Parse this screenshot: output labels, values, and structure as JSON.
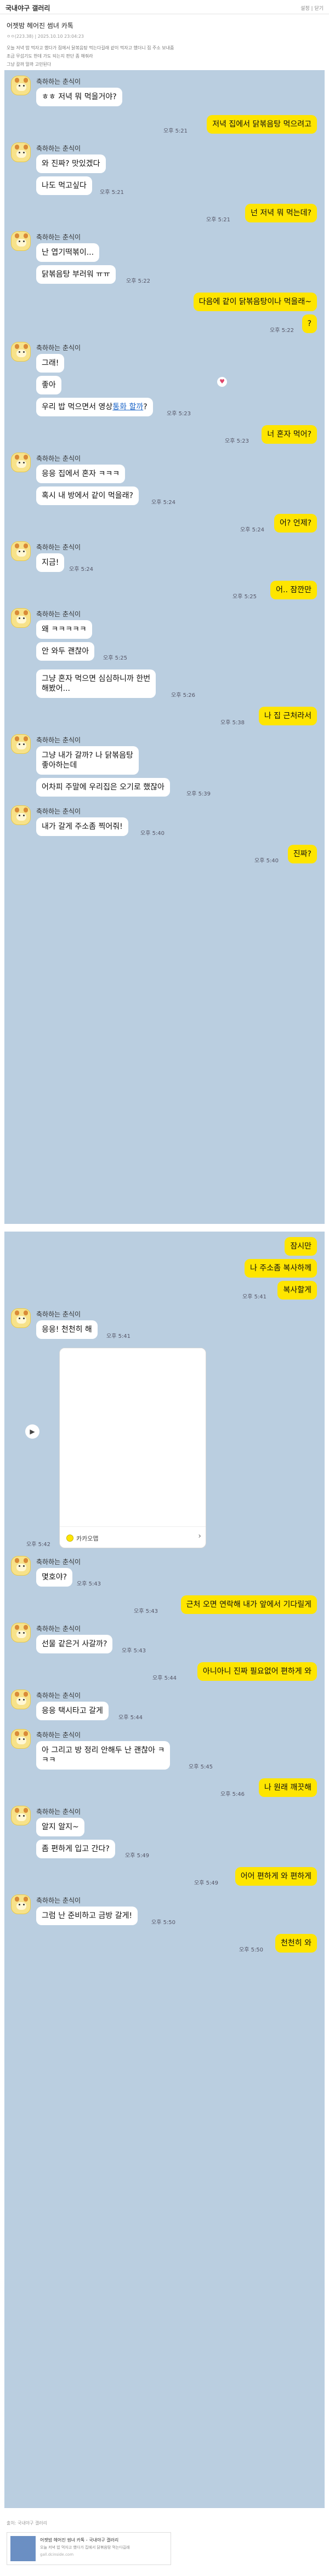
{
  "site": {
    "gallery": "국내야구 갤러리",
    "top_right": "설정 | 닫기"
  },
  "article": {
    "title": "어젯밤 헤어진 썸녀 카톡",
    "meta": "ㅇㅇ(223.38) | 2025.10.10 23:04:23",
    "body": [
      "오늘 저녁 밥 먹자고 했다가 집에서 닭볶음탕 먹는다길래 같이 먹자고 했더니 집 주소 보내줌",
      "조금 무섭기도 한데 가도 되는지 판단 좀 해줘라",
      "그냥 갈까 말까 고민된다"
    ]
  },
  "sender": "축하하는 춘식이",
  "chat": [
    {
      "s": "l",
      "name": true,
      "bubbles": [
        "ㅎㅎ 저녁 뭐 먹을거야?"
      ]
    },
    {
      "s": "r",
      "bubbles": [
        "저녁 집에서 닭볶음탕 먹으려고"
      ],
      "time": "오후 5:21"
    },
    {
      "s": "l",
      "name": true,
      "bubbles": [
        "와 진짜? 맛있겠다",
        "나도 먹고싶다"
      ],
      "time": "오후 5:21"
    },
    {
      "s": "r",
      "bubbles": [
        "넌 저녁 뭐 먹는데?"
      ],
      "time": "오후 5:21"
    },
    {
      "s": "l",
      "name": true,
      "bubbles": [
        "난 엽기떡볶이...",
        "닭볶음탕 부러워 ㅠㅠ"
      ],
      "time": "오후 5:22"
    },
    {
      "s": "r",
      "bubbles": [
        "다음에 같이 닭볶음탕이나 먹을래~",
        "?"
      ],
      "time": "오후 5:22"
    },
    {
      "s": "l",
      "name": true,
      "bubbles": [
        "그래!",
        "좋아",
        "우리 밥 먹으면서 영상통화 할까?"
      ],
      "time": "오후 5:23"
    },
    {
      "s": "r",
      "bubbles": [
        "너 혼자 먹어?"
      ],
      "time": "오후 5:23"
    },
    {
      "s": "l",
      "name": true,
      "bubbles": [
        "응응 집에서 혼자 ㅋㅋㅋ",
        "혹시 내 방에서 같이 먹을래?"
      ],
      "time": "오후 5:24"
    },
    {
      "s": "r",
      "bubbles": [
        "어? 언제?"
      ],
      "time": "오후 5:24"
    },
    {
      "s": "l",
      "name": true,
      "bubbles": [
        "지금!"
      ],
      "time": "오후 5:24"
    },
    {
      "s": "r",
      "bubbles": [
        "어.. 잠깐만"
      ],
      "time": "오후 5:25"
    },
    {
      "s": "l",
      "name": true,
      "bubbles": [
        "왜 ㅋㅋㅋㅋㅋ",
        "안 와두 괜찮아"
      ],
      "time": "오후 5:25"
    },
    {
      "s": "l",
      "name": false,
      "bubbles": [
        "그냥 혼자 먹으면 심심하니까 한번\n해봤어..."
      ],
      "time": "오후 5:26"
    },
    {
      "s": "r",
      "bubbles": [
        "나 집 근처라서"
      ],
      "time": "오후 5:38"
    },
    {
      "s": "l",
      "name": true,
      "bubbles": [
        "그냥 내가 갈까? 나 닭볶음탕\n좋아하는데",
        "어차피 주말에 우리집은 오기로 했잖아"
      ],
      "time": "오후 5:39"
    },
    {
      "s": "l",
      "name": true,
      "bubbles": [
        "내가 갈게 주소좀 찍어줘!"
      ],
      "time": "오후 5:40"
    },
    {
      "s": "r",
      "bubbles": [
        "진짜?"
      ],
      "time": "오후 5:40"
    },
    {
      "s": "r",
      "bubbles": [
        "잠시만",
        "나 주소좀 복사하께",
        "복사할게"
      ],
      "time": "오후 5:41"
    },
    {
      "s": "l",
      "name": true,
      "bubbles": [
        "응응! 천천히 해"
      ],
      "time": "오후 5:41"
    },
    {
      "s": "l",
      "name": true,
      "bubbles": [
        "몇호야?"
      ],
      "time": "오후 5:43"
    },
    {
      "s": "r",
      "bubbles": [
        "근처 오면 연락해 내가 앞에서 기다릴게"
      ],
      "time": "오후 5:43"
    },
    {
      "s": "l",
      "name": true,
      "bubbles": [
        "선물 같은거 사갈까?"
      ],
      "time": "오후 5:43"
    },
    {
      "s": "r",
      "bubbles": [
        "아니아니 진짜 필요없어 편하게 와"
      ],
      "time": "오후 5:44"
    },
    {
      "s": "l",
      "name": true,
      "bubbles": [
        "응응 택시타고 갈게"
      ],
      "time": "오후 5:44"
    },
    {
      "s": "l",
      "name": true,
      "bubbles": [
        "아 그리고 방 정리 안해두 난 괜찮아 ㅋ\nㅋㅋ"
      ],
      "time": "오후 5:45"
    },
    {
      "s": "r",
      "bubbles": [
        "나 원래 깨끗해"
      ],
      "time": "오후 5:46"
    },
    {
      "s": "l",
      "name": true,
      "bubbles": [
        "알지 알지~",
        "좀 편하게 입고 간다?"
      ],
      "time": "오후 5:49"
    },
    {
      "s": "r",
      "bubbles": [
        "어어 편하게 와 편하게"
      ],
      "time": "오후 5:49"
    },
    {
      "s": "l",
      "name": true,
      "bubbles": [
        "그럼 난 준비하고 금방 갈게!"
      ],
      "time": "오후 5:50"
    },
    {
      "s": "r",
      "bubbles": [
        "천천히 와"
      ],
      "time": "오후 5:50"
    }
  ],
  "map": {
    "label": "카카오맵",
    "time": "오후 5:42"
  },
  "source": {
    "text": "출처: 국내야구 갤러리",
    "card_title": "어젯밤 헤어진 썸녀 카톡 - 국내야구 갤러리",
    "card_desc": "오늘 저녁 밥 먹자고 했다가 집에서 닭볶음탕 먹는다길래",
    "card_site": "gall.dcinside.com"
  },
  "colors": {
    "chat_bg": "#bacee0",
    "my_bubble": "#fee500",
    "their_bubble": "#ffffff",
    "link": "#1a64c8"
  }
}
